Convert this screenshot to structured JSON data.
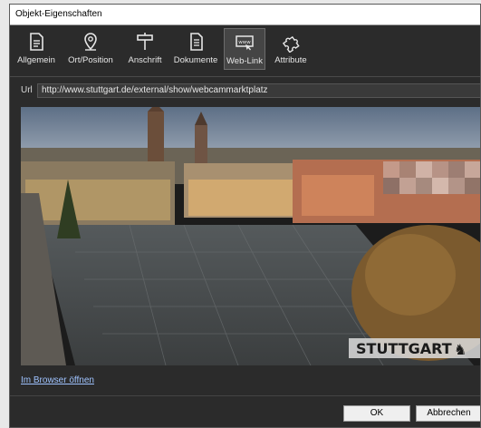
{
  "window": {
    "title": "Objekt-Eigenschaften"
  },
  "toolbar": {
    "items": [
      {
        "label": "Allgemein",
        "icon": "document-icon"
      },
      {
        "label": "Ort/Position",
        "icon": "location-pin-icon"
      },
      {
        "label": "Anschrift",
        "icon": "signpost-icon"
      },
      {
        "label": "Dokumente",
        "icon": "documents-icon"
      },
      {
        "label": "Web-Link",
        "icon": "web-link-icon",
        "active": true
      },
      {
        "label": "Attribute",
        "icon": "puzzle-icon"
      }
    ]
  },
  "url": {
    "label": "Url",
    "value": "http://www.stuttgart.de/external/show/webcammarktplatz"
  },
  "webcam": {
    "overlay_text": "STUTTGART"
  },
  "browser_link": {
    "label": "Im Browser öffnen"
  },
  "footer": {
    "ok_label": "OK",
    "cancel_label": "Abbrechen"
  },
  "colors": {
    "background": "#2b2b2b",
    "link": "#9fc3ff",
    "active_tab": "#454545"
  }
}
